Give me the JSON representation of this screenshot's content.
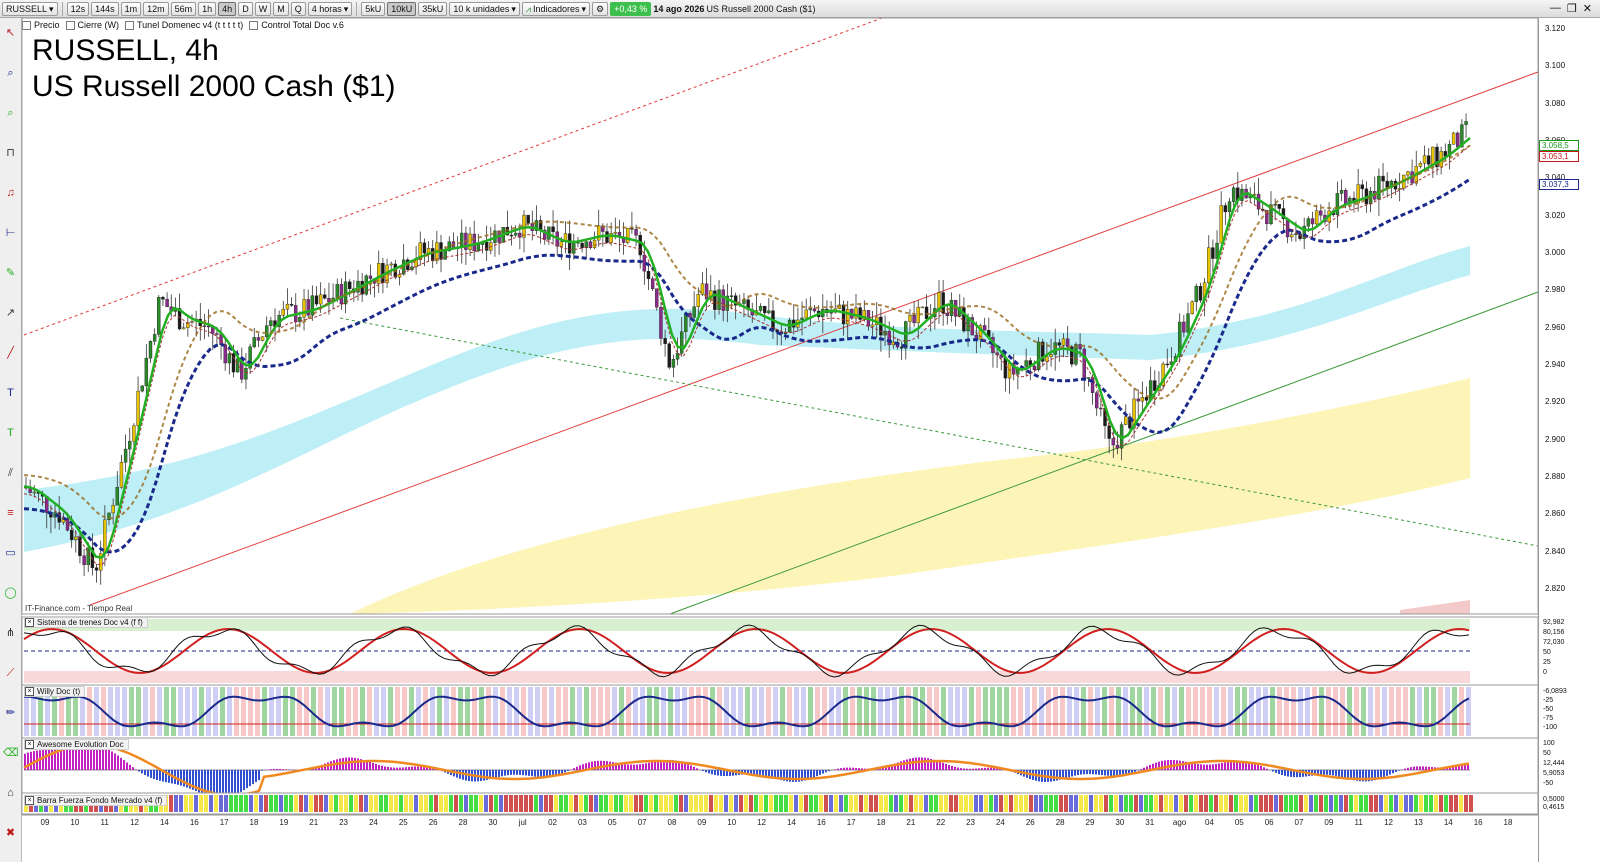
{
  "toolbar": {
    "symbol": "RUSSELL",
    "timeframes": [
      "12s",
      "144s",
      "1m",
      "12m",
      "56m",
      "1h",
      "4h",
      "D",
      "W",
      "M",
      "Q"
    ],
    "active_timeframe": "4h",
    "period": "4 horas",
    "units": [
      "5kU",
      "10kU",
      "35kU"
    ],
    "active_unit": "10kU",
    "unit_select": "10 k unidades",
    "indicators_label": "Indicadores",
    "change_pct": "+0,43 %",
    "date": "14 ago 2026",
    "instrument": "US Russell 2000 Cash ($1)"
  },
  "legend": [
    "Precio",
    "Cierre (W)",
    "Tunel Domenec v4 (t t t t t)",
    "Control Total Doc v.6"
  ],
  "title": {
    "line1": "RUSSELL, 4h",
    "line2": "US Russell 2000 Cash ($1)"
  },
  "source": "IT-Finance.com - Tiempo Real",
  "price_axis": {
    "ticks": [
      "3.120",
      "3.100",
      "3.080",
      "3.060",
      "3.040",
      "3.020",
      "3.000",
      "2.980",
      "2.960",
      "2.940",
      "2.920",
      "2.900",
      "2.880",
      "2.860",
      "2.840",
      "2.820"
    ],
    "labels": [
      {
        "text": "3.058,5",
        "color": "#1a9a1a"
      },
      {
        "text": "3.053,1",
        "color": "#c01818"
      },
      {
        "text": "3.037,3",
        "color": "#1a2a8c"
      }
    ]
  },
  "panels": [
    {
      "name": "Sistema de trenes Doc v4 (f f)",
      "ticks": [
        "92,982",
        "80,156",
        "72,030",
        "50",
        "25",
        "0"
      ]
    },
    {
      "name": "Willy Doc (t)",
      "ticks": [
        "-6,0893",
        "-25",
        "-50",
        "-75",
        "-100"
      ]
    },
    {
      "name": "Awesome Evolution Doc",
      "ticks": [
        "100",
        "50",
        "12,444",
        "5,9053",
        "-50"
      ]
    },
    {
      "name": "Barra Fuerza Fondo Mercado v4 (f)",
      "ticks": [
        "0,5000",
        "0,4615"
      ]
    }
  ],
  "x_axis": [
    "09",
    "10",
    "11",
    "12",
    "14",
    "16",
    "17",
    "18",
    "19",
    "21",
    "23",
    "24",
    "25",
    "26",
    "28",
    "30",
    "jul",
    "02",
    "03",
    "05",
    "07",
    "08",
    "09",
    "10",
    "12",
    "14",
    "16",
    "17",
    "18",
    "21",
    "22",
    "23",
    "24",
    "26",
    "28",
    "29",
    "30",
    "31",
    "ago",
    "04",
    "05",
    "06",
    "07",
    "09",
    "11",
    "12",
    "13",
    "14",
    "16",
    "18"
  ],
  "colors": {
    "ema_fast": "#22b022",
    "ema_slow": "#c01818",
    "trend": "#1a2a8c",
    "cloud_blue": "#9be7f2",
    "cloud_yellow": "#fdf1a6",
    "channel": "#e23a3a",
    "support": "#3a9a3a"
  }
}
